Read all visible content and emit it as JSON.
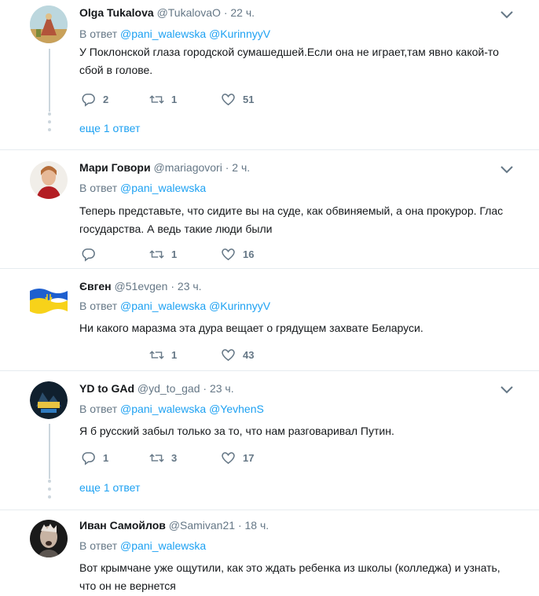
{
  "tweets": [
    {
      "name": "Olga Tukalova",
      "handle": "@TukalovaO",
      "time": "· 22 ч.",
      "reply_prefix": "В ответ",
      "reply_to": [
        "@pani_walewska",
        "@KurinnyyV"
      ],
      "text": "У Поклонской глаза городской сумашедшей.Если она не играет,там явно какой-то сбой в голове.",
      "replies": "2",
      "retweets": "1",
      "likes": "51",
      "more": "еще 1 ответ"
    },
    {
      "name": "Мари Говори",
      "handle": "@mariagovori",
      "time": "· 2 ч.",
      "reply_prefix": "В ответ",
      "reply_to": [
        "@pani_walewska"
      ],
      "text": "Теперь представьте, что сидите вы на суде, как обвиняемый, а она прокурор. Глас государства. А ведь такие люди были",
      "replies": "",
      "retweets": "1",
      "likes": "16"
    },
    {
      "name": "Євген",
      "handle": "@51evgen",
      "time": "· 23 ч.",
      "reply_prefix": "В ответ",
      "reply_to": [
        "@pani_walewska",
        "@KurinnyyV"
      ],
      "text": "Ни какого маразма эта дура вещает о грядущем захвате Беларуси.",
      "replies": "",
      "retweets": "1",
      "likes": "43"
    },
    {
      "name": "YD to GAd",
      "handle": "@yd_to_gad",
      "time": "· 23 ч.",
      "reply_prefix": "В ответ",
      "reply_to": [
        "@pani_walewska",
        "@YevhenS"
      ],
      "text": "Я б русский забыл только за то, что нам разговаривал Путин.",
      "replies": "1",
      "retweets": "3",
      "likes": "17",
      "more": "еще 1 ответ"
    },
    {
      "name": "Иван Самойлов",
      "handle": "@Samivan21",
      "time": "· 18 ч.",
      "reply_prefix": "В ответ",
      "reply_to": [
        "@pani_walewska"
      ],
      "text": "Вот крымчане уже ощутили, как это ждать ребенка из школы (колледжа) и узнать, что он не вернется"
    }
  ],
  "colors": {
    "accent": "#1da1f2",
    "muted": "#657786",
    "border": "#e6ecf0",
    "text": "#14171a"
  },
  "icons": [
    "reply-icon",
    "retweet-icon",
    "like-icon",
    "chevron-down-icon"
  ]
}
